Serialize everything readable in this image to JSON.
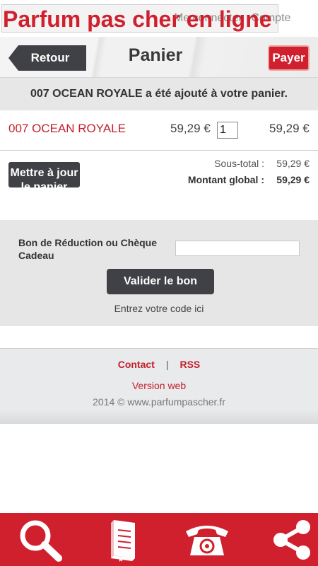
{
  "banner": {
    "title": "Parfum pas cher en ligne",
    "link_connect": "Me connecter",
    "link_account": "Compte"
  },
  "header": {
    "back_label": "Retour",
    "title": "Panier",
    "pay_label": "Payer"
  },
  "message": "007 OCEAN ROYALE a été ajouté à votre panier.",
  "cart": {
    "items": [
      {
        "name": "007 OCEAN ROYALE",
        "price": "59,29 €",
        "qty": "1",
        "total": "59,29 €"
      }
    ],
    "update_label": "Mettre à jour le panier",
    "subtotal_label": "Sous-total :",
    "subtotal_value": "59,29 €",
    "grand_label": "Montant global :",
    "grand_value": "59,29 €"
  },
  "voucher": {
    "label": "Bon de Réduction ou Chèque Cadeau",
    "input_value": "",
    "button_label": "Valider le bon",
    "hint": "Entrez votre code ici"
  },
  "footer": {
    "contact": "Contact",
    "separator": "|",
    "rss": "RSS",
    "web_version": "Version web",
    "copyright": "2014 © www.parfumpascher.fr"
  },
  "bottom_bar": {
    "items": [
      "search-icon",
      "catalog-book-icon",
      "phone-icon",
      "share-icon"
    ]
  },
  "colors": {
    "brand_red": "#d0202e",
    "dark_button": "#3f4146"
  }
}
